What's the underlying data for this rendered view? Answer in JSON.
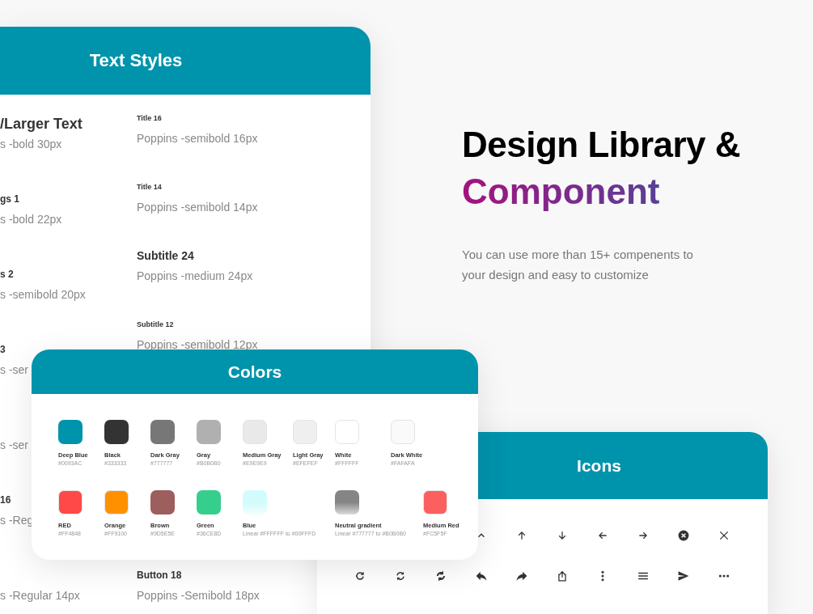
{
  "text_styles": {
    "title": "Text Styles",
    "left_column": [
      {
        "kind": "large",
        "label": "/Larger Text",
        "spec": "s -bold 30px"
      },
      {
        "kind": "small",
        "label": "gs 1",
        "spec": "s -bold 22px"
      },
      {
        "kind": "small",
        "label": "s 2",
        "spec": "s -semibold 20px"
      },
      {
        "kind": "small",
        "label": "3",
        "spec": "s -ser"
      },
      {
        "spec": "s -ser"
      },
      {
        "kind": "small",
        "label": "16",
        "spec": "s -Reg"
      },
      {
        "spec": "s -Regular 14px"
      }
    ],
    "right_column": [
      {
        "kind": "tiny",
        "label": "Title 16",
        "spec": "Poppins -semibold 16px"
      },
      {
        "kind": "tiny",
        "label": "Title 14",
        "spec": "Poppins -semibold 14px"
      },
      {
        "kind": "medium",
        "label": "Subtitle 24",
        "spec": "Poppins -medium 24px"
      },
      {
        "kind": "tiny",
        "label": "Subtitle 12",
        "spec": "Poppins -semibold 12px"
      },
      {
        "kind": "button",
        "label": "Button 18",
        "spec": "Poppins -Semibold  18px"
      }
    ]
  },
  "hero": {
    "title": "Design Library &",
    "highlight": "Component",
    "description": "You can use more than 15+ compenents to your design and easy to customize"
  },
  "colors": {
    "title": "Colors",
    "rows": [
      [
        {
          "kind": "solid",
          "name": "Deep Blue",
          "code": "#0093AC",
          "color": "#0093ac"
        },
        {
          "kind": "solid",
          "name": "Black",
          "code": "#333333",
          "color": "#333333"
        },
        {
          "kind": "solid",
          "name": "Dark Gray",
          "code": "#777777",
          "color": "#777777"
        },
        {
          "kind": "solid",
          "name": "Gray",
          "code": "#B0B0B0",
          "color": "#b0b0b0"
        },
        {
          "kind": "solid",
          "name": "Medium Gray",
          "code": "#E9E9E9",
          "color": "#e9e9e9"
        },
        {
          "kind": "solid",
          "name": "Light Gray",
          "code": "#EFEFEF",
          "color": "#efefef"
        },
        {
          "kind": "solid",
          "name": "White",
          "code": "#FFFFFF",
          "color": "#ffffff"
        },
        {
          "kind": "solid",
          "name": "Dark White",
          "code": "#FAFAFA",
          "color": "#fafafa"
        }
      ],
      [
        {
          "kind": "solid",
          "name": "RED",
          "code": "#FF4848",
          "color": "#ff4848"
        },
        {
          "kind": "solid",
          "name": "Orange",
          "code": "#FF9100",
          "color": "#ff9100"
        },
        {
          "kind": "solid",
          "name": "Brown",
          "code": "#9D5E5E",
          "color": "#9d5e5e"
        },
        {
          "kind": "solid",
          "name": "Green",
          "code": "#36CE8D",
          "color": "#36ce8d"
        },
        {
          "kind": "gradient",
          "name": "Blue",
          "code": "Linear #FFFFFF to #00FFFD",
          "color": "#d2fcfc"
        },
        "",
        {
          "kind": "gradient",
          "name": "Neutral gradient",
          "code": "Linear #777777 to #B0B0B0",
          "color": "#858585"
        },
        "",
        {
          "kind": "solid",
          "name": "Medium Red",
          "code": "#FC5F5F",
          "color": "#fc5f5f"
        }
      ]
    ]
  },
  "icons": {
    "title": "Icons"
  }
}
